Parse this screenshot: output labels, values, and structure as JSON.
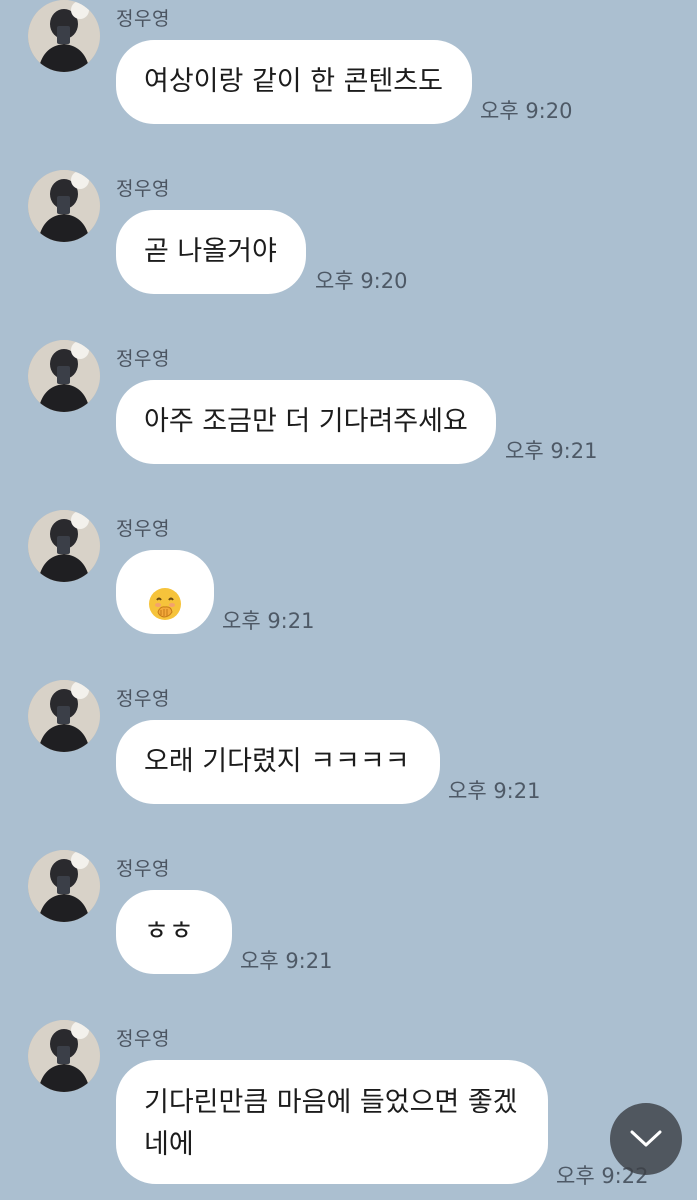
{
  "colors": {
    "background": "#abbfd0",
    "bubble": "#ffffff",
    "scroll_button": "#3c4046"
  },
  "messages": [
    {
      "sender": "정우영",
      "text": "여상이랑 같이 한 콘텐츠도",
      "time": "오후 9:20"
    },
    {
      "sender": "정우영",
      "text": "곧 나올거야",
      "time": "오후 9:20"
    },
    {
      "sender": "정우영",
      "text": "아주 조금만 더 기다려주세요",
      "time": "오후 9:21"
    },
    {
      "sender": "정우영",
      "emoji": "face-with-hand-over-mouth-emoji",
      "time": "오후 9:21"
    },
    {
      "sender": "정우영",
      "text": "오래 기다렸지 ㅋㅋㅋㅋ",
      "time": "오후 9:21"
    },
    {
      "sender": "정우영",
      "text": "ㅎㅎ",
      "time": "오후 9:21"
    },
    {
      "sender": "정우영",
      "text_line1": "기다린만큼 마음에 들었으면 좋겠",
      "text_line2": "네에",
      "time": "오후 9:22"
    }
  ],
  "scroll_button": {
    "icon": "chevron-down-icon"
  }
}
